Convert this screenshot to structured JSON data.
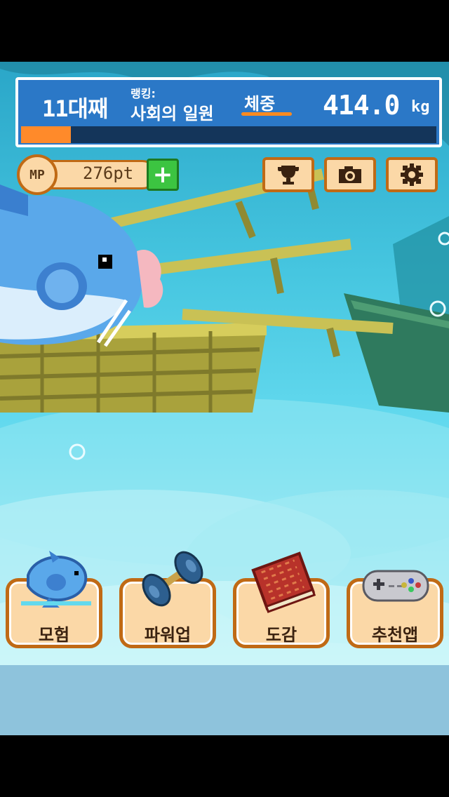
{
  "status": {
    "generation": "11대째",
    "ranking_label": "랭킹:",
    "ranking_value": "사회의 일원",
    "weight_label": "체중",
    "weight_value": "414.0",
    "weight_unit": "kg",
    "progress": 0.12
  },
  "mp": {
    "badge": "MP",
    "value": "276pt",
    "add_icon": "plus-icon"
  },
  "toolbar": {
    "trophy_icon": "trophy-icon",
    "camera_icon": "camera-icon",
    "settings_icon": "gear-icon"
  },
  "menu": [
    {
      "label": "모험",
      "icon": "sunfish-icon"
    },
    {
      "label": "파워업",
      "icon": "dumbbell-icon"
    },
    {
      "label": "도감",
      "icon": "book-icon"
    },
    {
      "label": "추천앱",
      "icon": "gamepad-icon"
    }
  ],
  "colors": {
    "panel_blue": "#2b78c7",
    "progress_orange": "#ff8a2a",
    "button_fill": "#fbd8a7",
    "button_border": "#c06a15",
    "plus_green": "#3cc441"
  }
}
